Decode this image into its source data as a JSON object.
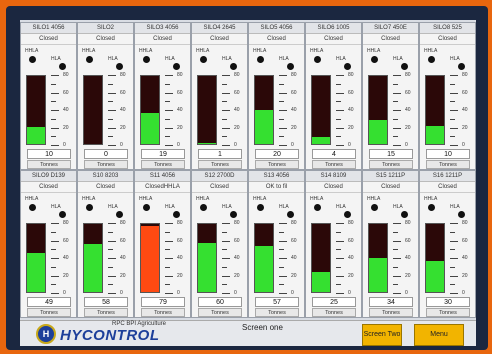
{
  "scale_ticks": [
    "80",
    "60",
    "40",
    "20",
    "0"
  ],
  "unit_label": "Tonnes",
  "alarm_labels": {
    "hhla": "HHLA",
    "hla": "HLA"
  },
  "silos_row1": [
    {
      "name": "SILO1 4056",
      "status": "Closed",
      "value": "10",
      "level": 0.25
    },
    {
      "name": "SILO2",
      "status": "Closed",
      "value": "0",
      "level": 0.0
    },
    {
      "name": "SILO3 4056",
      "status": "Closed",
      "value": "19",
      "level": 0.45
    },
    {
      "name": "SILO4 2645",
      "status": "Closed",
      "value": "1",
      "level": 0.02
    },
    {
      "name": "SILO5 4056",
      "status": "Closed",
      "value": "20",
      "level": 0.5
    },
    {
      "name": "SILO6 1005",
      "status": "Closed",
      "value": "4",
      "level": 0.1
    },
    {
      "name": "SILO7 450E",
      "status": "Closed",
      "value": "15",
      "level": 0.36
    },
    {
      "name": "SILO8 525",
      "status": "Closed",
      "value": "10",
      "level": 0.26
    }
  ],
  "silos_row2": [
    {
      "name": "SILO9 D139",
      "status": "Closed",
      "value": "49",
      "level": 0.58
    },
    {
      "name": "S10 8203",
      "status": "Closed",
      "value": "58",
      "level": 0.7
    },
    {
      "name": "S11 4056",
      "status": "ClosedHHLA",
      "value": "79",
      "level": 0.97,
      "alert": true
    },
    {
      "name": "S12 2700D",
      "status": "Closed",
      "value": "60",
      "level": 0.72
    },
    {
      "name": "S13 4056",
      "status": "OK to fil",
      "value": "57",
      "level": 0.68
    },
    {
      "name": "S14 8109",
      "status": "Closed",
      "value": "25",
      "level": 0.3
    },
    {
      "name": "S15 1211P",
      "status": "Closed",
      "value": "34",
      "level": 0.5
    },
    {
      "name": "S16 1211P",
      "status": "Closed",
      "value": "30",
      "level": 0.45
    }
  ],
  "footer": {
    "company": "RPC BPI Agriculture",
    "brand": "HYCONTROL",
    "logo_letter": "H",
    "screen_name": "Screen one",
    "screen_two_button": "Screen Two",
    "menu_button": "Menu"
  },
  "colors": {
    "fill_ok": "#35e030",
    "fill_alert": "#ff4a12",
    "button": "#f2b400"
  }
}
